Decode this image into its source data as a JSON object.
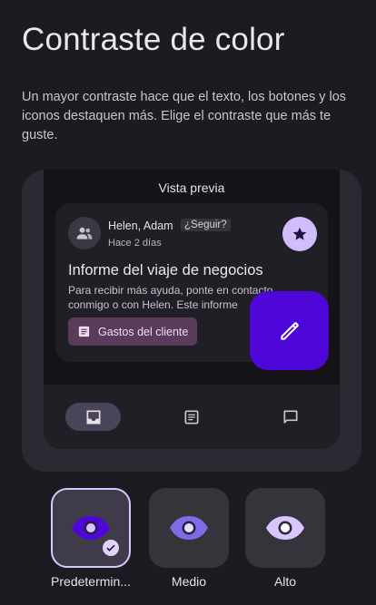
{
  "page": {
    "title": "Contraste de color",
    "description": "Un mayor contraste hace que el texto, los botones y los iconos destaquen más. Elige el contraste que más te guste."
  },
  "preview": {
    "label": "Vista previa",
    "email": {
      "sender": "Helen, Adam",
      "follow_chip": "¿Seguir?",
      "time": "Hace 2 días",
      "subject": "Informe del viaje de negocios",
      "snippet": "Para recibir más ayuda, ponte en contacto conmigo o con Helen. Este informe",
      "attachment": "Gastos del cliente"
    },
    "nav_icons": [
      "inbox-icon",
      "article-icon",
      "chat-bubble-icon"
    ]
  },
  "options": [
    {
      "label": "Predeterminado",
      "display": "Predetermin...",
      "selected": true,
      "icon_fill": "#4f06d8"
    },
    {
      "label": "Medio",
      "display": "Medio",
      "selected": false,
      "icon_fill": "#7c6ce8"
    },
    {
      "label": "Alto",
      "display": "Alto",
      "selected": false,
      "icon_fill": "#d9c6ff"
    }
  ],
  "colors": {
    "background": "#1c1b22",
    "accent": "#4f06d8",
    "star_button": "#cfbdfe",
    "attachment_chip": "#5b3b5a",
    "selected_border": "#d9c6ff"
  }
}
